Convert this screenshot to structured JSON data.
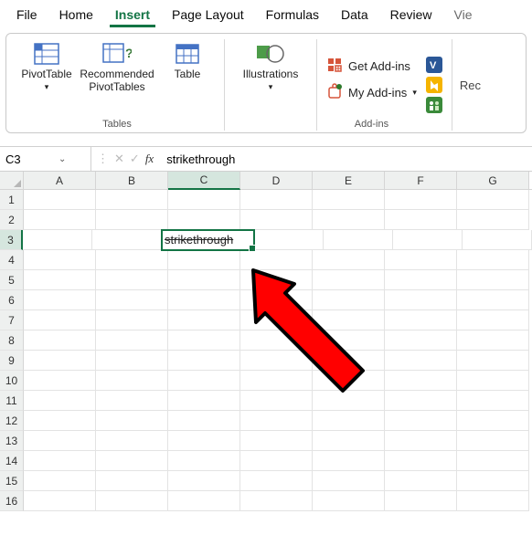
{
  "tabs": [
    "File",
    "Home",
    "Insert",
    "Page Layout",
    "Formulas",
    "Data",
    "Review",
    "Vie"
  ],
  "active_tab": 2,
  "ribbon": {
    "tables": {
      "pivottable": "PivotTable",
      "recommended": "Recommended\nPivotTables",
      "table": "Table",
      "group_label": "Tables"
    },
    "illustrations": {
      "label": "Illustrations"
    },
    "addins": {
      "get": "Get Add-ins",
      "my": "My Add-ins",
      "group_label": "Add-ins"
    },
    "rec_cut": "Rec"
  },
  "namebox": "C3",
  "formula": "strikethrough",
  "columns": [
    "A",
    "B",
    "C",
    "D",
    "E",
    "F",
    "G"
  ],
  "selected_col_index": 2,
  "row_count": 16,
  "selected_row": 3,
  "cells": {
    "C3": "strikethrough"
  },
  "accent": "#137445"
}
